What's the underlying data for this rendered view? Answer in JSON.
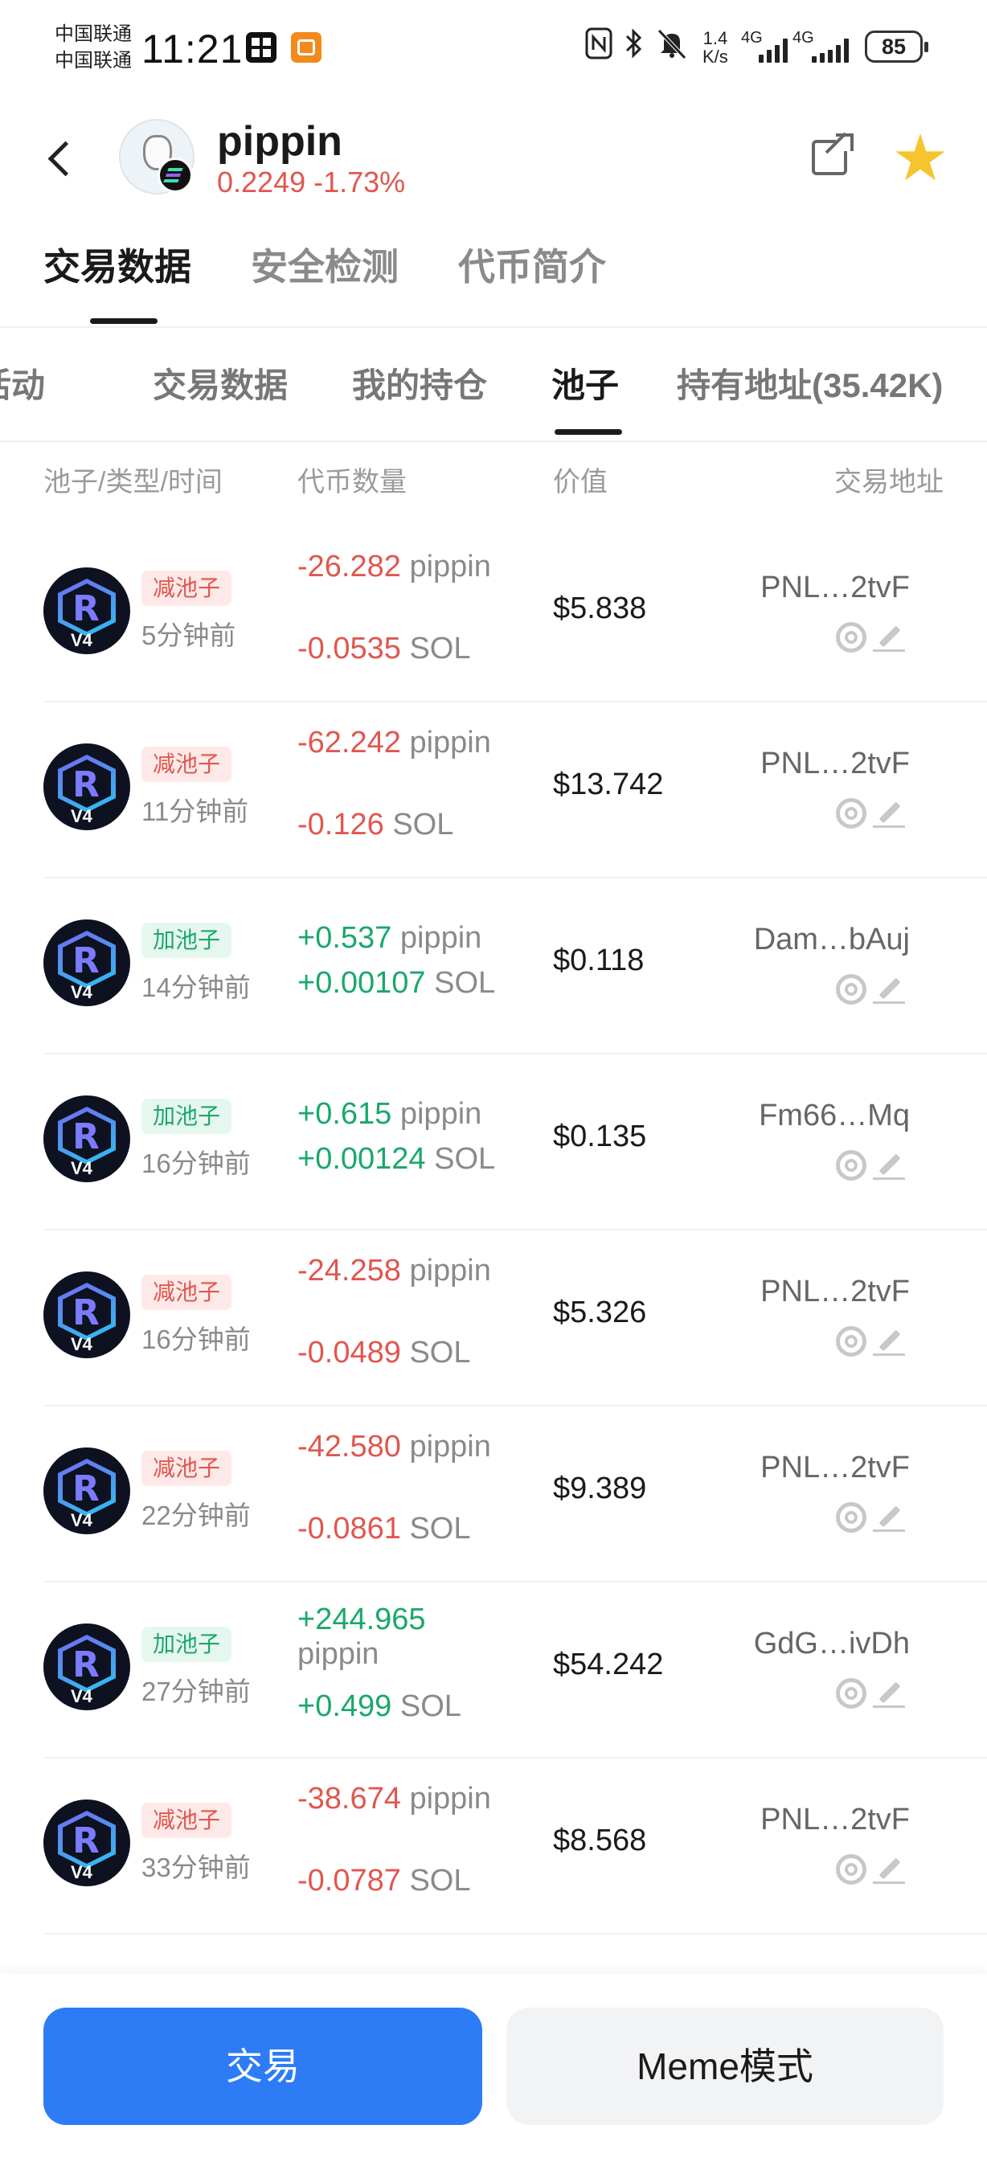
{
  "status_bar": {
    "carrier_1": "中国联通",
    "carrier_2": "中国联通",
    "time": "11:21",
    "speed_value": "1.4",
    "speed_unit": "K/s",
    "net_1": "4G",
    "net_2": "4G",
    "battery": "85"
  },
  "header": {
    "token_name": "pippin",
    "price": "0.2249",
    "change": "-1.73%",
    "price_color": "#e0574f",
    "star_color": "#f6c42c"
  },
  "primary_tabs": [
    "交易数据",
    "安全检测",
    "代币简介"
  ],
  "primary_active": 0,
  "secondary_tabs": [
    "活动",
    "交易数据",
    "我的持仓",
    "池子",
    "持有地址(35.42K)"
  ],
  "secondary_active": 3,
  "columns": {
    "pool": "池子/类型/时间",
    "amount": "代币数量",
    "value": "价值",
    "address": "交易地址"
  },
  "rows": [
    {
      "type": "减池子",
      "time": "5分钟前",
      "token_amt": "-26.282",
      "token_unit": "pippin",
      "sol_amt": "-0.0535",
      "sol_unit": "SOL",
      "value": "$5.838",
      "address": "PNL…2tvF",
      "pool_badge": "V4"
    },
    {
      "type": "减池子",
      "time": "11分钟前",
      "token_amt": "-62.242",
      "token_unit": "pippin",
      "sol_amt": "-0.126",
      "sol_unit": "SOL",
      "value": "$13.742",
      "address": "PNL…2tvF",
      "pool_badge": "V4"
    },
    {
      "type": "加池子",
      "time": "14分钟前",
      "token_amt": "+0.537",
      "token_unit": "pippin",
      "sol_amt": "+0.00107",
      "sol_unit": "SOL",
      "value": "$0.118",
      "address": "Dam…bAuj",
      "pool_badge": "V4"
    },
    {
      "type": "加池子",
      "time": "16分钟前",
      "token_amt": "+0.615",
      "token_unit": "pippin",
      "sol_amt": "+0.00124",
      "sol_unit": "SOL",
      "value": "$0.135",
      "address": "Fm66…Mq",
      "pool_badge": "V4"
    },
    {
      "type": "减池子",
      "time": "16分钟前",
      "token_amt": "-24.258",
      "token_unit": "pippin",
      "sol_amt": "-0.0489",
      "sol_unit": "SOL",
      "value": "$5.326",
      "address": "PNL…2tvF",
      "pool_badge": "V4"
    },
    {
      "type": "减池子",
      "time": "22分钟前",
      "token_amt": "-42.580",
      "token_unit": "pippin",
      "sol_amt": "-0.0861",
      "sol_unit": "SOL",
      "value": "$9.389",
      "address": "PNL…2tvF",
      "pool_badge": "V4"
    },
    {
      "type": "加池子",
      "time": "27分钟前",
      "token_amt": "+244.965",
      "token_unit": "pippin",
      "sol_amt": "+0.499",
      "sol_unit": "SOL",
      "value": "$54.242",
      "address": "GdG…ivDh",
      "pool_badge": "V4"
    },
    {
      "type": "减池子",
      "time": "33分钟前",
      "token_amt": "-38.674",
      "token_unit": "pippin",
      "sol_amt": "-0.0787",
      "sol_unit": "SOL",
      "value": "$8.568",
      "address": "PNL…2tvF",
      "pool_badge": "V4"
    }
  ],
  "bottom": {
    "trade_label": "交易",
    "meme_label": "Meme模式"
  },
  "colors": {
    "negative": "#e0574f",
    "positive": "#1aa86b",
    "primary_button": "#2d7cf6"
  },
  "icons": [
    "back-icon",
    "share-icon",
    "star-icon",
    "solana-icon",
    "scan-icon",
    "edit-icon",
    "raydium-icon"
  ]
}
